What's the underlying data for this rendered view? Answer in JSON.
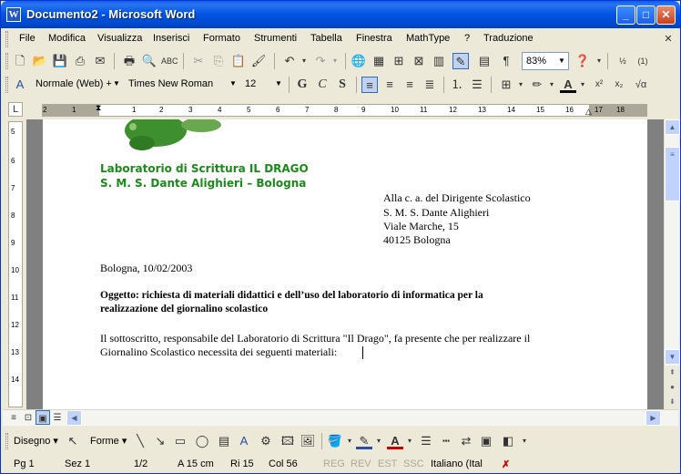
{
  "window": {
    "title": "Documento2 - Microsoft Word"
  },
  "menu": [
    "File",
    "Modifica",
    "Visualizza",
    "Inserisci",
    "Formato",
    "Strumenti",
    "Tabella",
    "Finestra",
    "MathType",
    "?",
    "Traduzione"
  ],
  "standard_toolbar": {
    "zoom": "83%"
  },
  "format_toolbar": {
    "style": "Normale (Web) +",
    "font": "Times New Roman",
    "size": "12",
    "bold": "G",
    "italic": "C",
    "shadow": "S"
  },
  "document": {
    "header_line1": "Laboratorio di Scrittura IL DRAGO",
    "header_line2": "S. M. S. Dante Alighieri – Bologna",
    "address": [
      "Alla c. a. del Dirigente Scolastico",
      "S. M. S. Dante Alighieri",
      "Viale Marche, 15",
      "40125 Bologna"
    ],
    "date_line": "Bologna, 10/02/2003",
    "subject_line1": "Oggetto: richiesta di materiali didattici  e dell’uso del laboratorio di informatica per la",
    "subject_line2": "realizzazione del giornalino scolastico",
    "body_line1": "Il sottoscritto, responsabile del Laboratorio di Scrittura \"Il Drago\", fa presente che per realizzare il",
    "body_line2": "Giornalino Scolastico necessita dei seguenti materiali:"
  },
  "drawing_toolbar": {
    "draw_label": "Disegno",
    "shapes_label": "Forme"
  },
  "status": {
    "page": "Pg 1",
    "section": "Sez 1",
    "pages": "1/2",
    "at": "A  15 cm",
    "line": "Ri  15",
    "col": "Col 56",
    "reg": "REG",
    "rev": "REV",
    "est": "EST",
    "ssc": "SSC",
    "language": "Italiano (Ital"
  },
  "ruler": {
    "marks": [
      "2",
      "1",
      "1",
      "2",
      "3",
      "4",
      "5",
      "6",
      "7",
      "8",
      "9",
      "10",
      "11",
      "12",
      "13",
      "14",
      "15",
      "16",
      "17",
      "18"
    ]
  },
  "vruler": {
    "marks": [
      "5",
      "6",
      "7",
      "8",
      "9",
      "10",
      "11",
      "12",
      "13",
      "14"
    ]
  }
}
